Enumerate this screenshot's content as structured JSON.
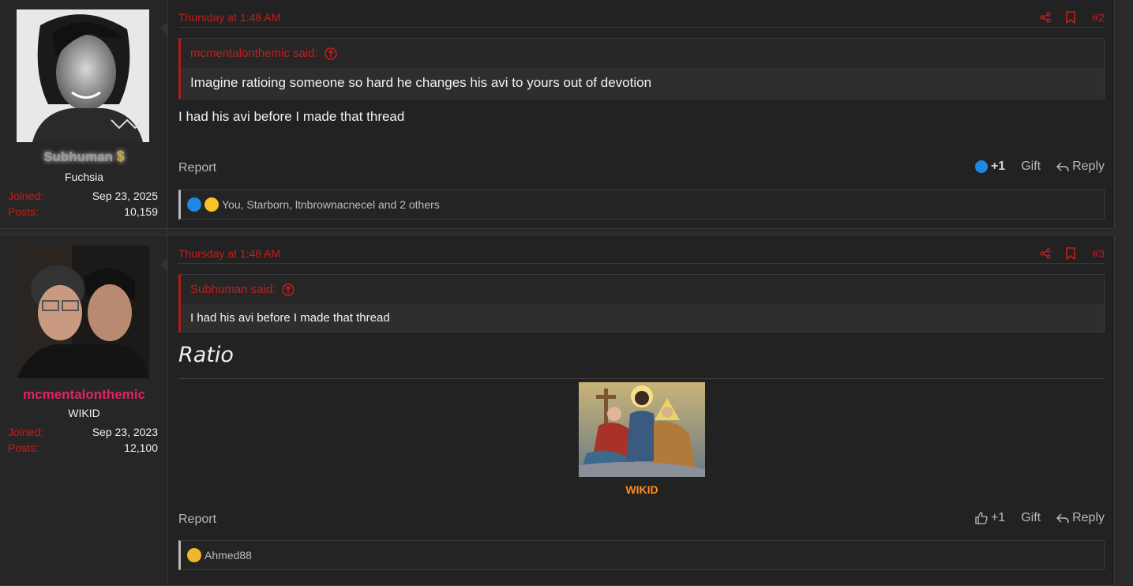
{
  "posts": [
    {
      "username": "Subhuman",
      "user_title": "Fuchsia",
      "joined_label": "Joined:",
      "joined": "Sep 23, 2025",
      "posts_label": "Posts:",
      "posts": "10,159",
      "date": "Thursday at 1:48 AM",
      "number": "#2",
      "quote_author": "mcmentalonthemic said:",
      "quote_text": "Imagine ratioing someone so hard he changes his avi to yours out of devotion",
      "body": "I had his avi before I made that thread",
      "report": "Report",
      "like_count": "+1",
      "gift": "Gift",
      "reply": "Reply",
      "reactions_text": "You, Starborn, ltnbrownacnecel and 2 others"
    },
    {
      "username": "mcmentalonthemic",
      "user_title": "WIKID",
      "joined_label": "Joined:",
      "joined": "Sep 23, 2023",
      "posts_label": "Posts:",
      "posts": "12,100",
      "date": "Thursday at 1:48 AM",
      "number": "#3",
      "quote_author": "Subhuman said:",
      "quote_text": "I had his avi before I made that thread",
      "body": "Ratio",
      "signature_caption": "WIKID",
      "report": "Report",
      "like_count": "+1",
      "gift": "Gift",
      "reply": "Reply",
      "reactions_text": "Ahmed88"
    }
  ],
  "colors": {
    "accent_red": "#c41e1e",
    "username_pink": "#e0245e",
    "signature_orange": "#ff8c1a",
    "like_blue": "#1e88e5"
  },
  "icons": [
    "share-icon",
    "bookmark-icon",
    "quote-arrow-up-icon",
    "like-icon",
    "reply-icon",
    "dollar-icon"
  ]
}
